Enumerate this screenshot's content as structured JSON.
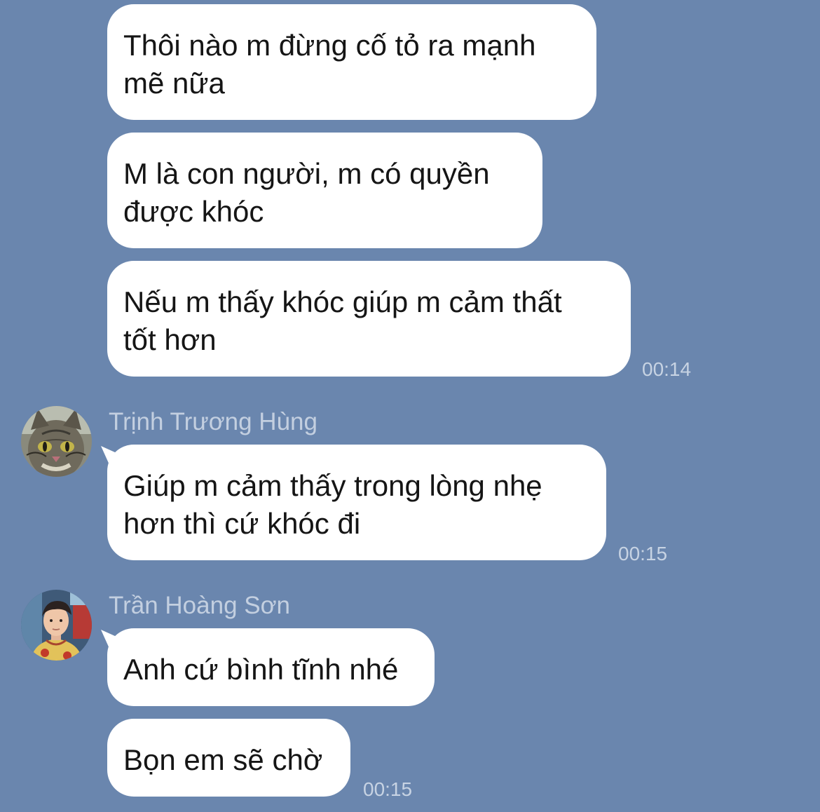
{
  "groups": [
    {
      "sender": null,
      "messages": [
        "Thôi nào m đừng cố tỏ ra mạnh\nmẽ nữa",
        "M là con người, m có quyền\nđược khóc",
        "Nếu m thấy khóc giúp m cảm thất\ntốt hơn"
      ],
      "time": "00:14"
    },
    {
      "sender": "Trịnh Trương Hùng",
      "avatar": "cat-avatar",
      "messages": [
        "Giúp m cảm thấy trong lòng nhẹ\nhơn thì cứ khóc đi"
      ],
      "time": "00:15"
    },
    {
      "sender": "Trần Hoàng Sơn",
      "avatar": "person-avatar",
      "messages": [
        "Anh cứ bình tĩnh nhé",
        "Bọn em sẽ chờ"
      ],
      "time": "00:15"
    }
  ]
}
